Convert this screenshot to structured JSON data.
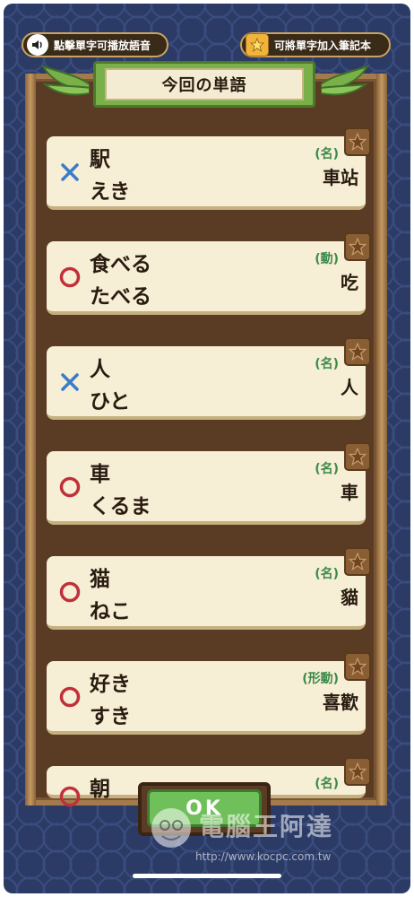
{
  "header": {
    "audio_hint": "點擊單字可播放語音",
    "notebook_hint": "可將單字加入筆記本",
    "title": "今回の単語"
  },
  "words": [
    {
      "kanji": "駅",
      "kana": "えき",
      "pos": "(名)",
      "meaning": "車站",
      "result": "wrong"
    },
    {
      "kanji": "食べる",
      "kana": "たべる",
      "pos": "(動)",
      "meaning": "吃",
      "result": "correct"
    },
    {
      "kanji": "人",
      "kana": "ひと",
      "pos": "(名)",
      "meaning": "人",
      "result": "wrong"
    },
    {
      "kanji": "車",
      "kana": "くるま",
      "pos": "(名)",
      "meaning": "車",
      "result": "correct"
    },
    {
      "kanji": "猫",
      "kana": "ねこ",
      "pos": "(名)",
      "meaning": "貓",
      "result": "correct"
    },
    {
      "kanji": "好き",
      "kana": "すき",
      "pos": "(形動)",
      "meaning": "喜歡",
      "result": "correct"
    },
    {
      "kanji": "朝",
      "kana": "",
      "pos": "(名)",
      "meaning": "",
      "result": "correct"
    }
  ],
  "ok_label": "OK",
  "watermark": {
    "text": "電腦王阿達",
    "url": "http://www.kocpc.com.tw"
  },
  "colors": {
    "wrong": "#3a7cc8",
    "correct": "#c0303a",
    "pos": "#3c8a4a",
    "board": "#5a3b23",
    "card": "#f6eed5"
  }
}
